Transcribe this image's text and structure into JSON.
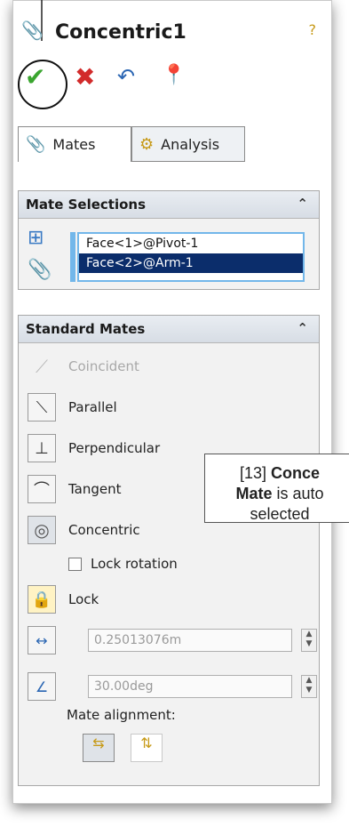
{
  "title": "Concentric1",
  "tabs": [
    {
      "label": "Mates"
    },
    {
      "label": "Analysis"
    }
  ],
  "mate_selections": {
    "header": "Mate Selections",
    "items": [
      "Face<1>@Pivot-1",
      "Face<2>@Arm-1"
    ]
  },
  "standard_mates": {
    "header": "Standard Mates",
    "items": [
      {
        "label": "Coincident"
      },
      {
        "label": "Parallel"
      },
      {
        "label": "Perpendicular"
      },
      {
        "label": "Tangent"
      },
      {
        "label": "Concentric"
      }
    ],
    "lock_rotation": "Lock rotation",
    "lock": "Lock",
    "distance_value": "0.25013076m",
    "angle_value": "30.00deg",
    "mate_alignment": "Mate alignment:"
  },
  "callout": {
    "prefix": "[13] ",
    "bold1": "Conce",
    "bold2": "Mate",
    "rest1": " is auto",
    "rest2": "selected"
  },
  "colors": {
    "accent": "#0b2d6b",
    "selection_border": "#72b7ea",
    "ok_green": "#3aa52f",
    "cancel_red": "#d22b2b"
  }
}
